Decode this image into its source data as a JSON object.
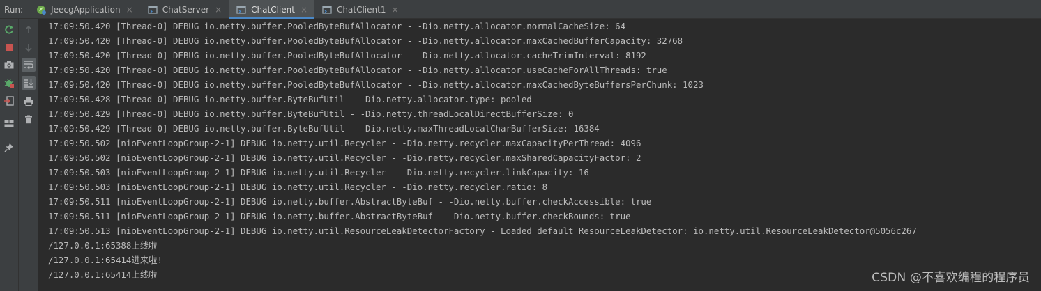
{
  "run_label": "Run:",
  "tabs": [
    {
      "label": "JeecgApplication",
      "icon": "spring-app-icon"
    },
    {
      "label": "ChatServer",
      "icon": "run-config-icon"
    },
    {
      "label": "ChatClient",
      "icon": "run-config-icon",
      "active": true
    },
    {
      "label": "ChatClient1",
      "icon": "run-config-icon"
    }
  ],
  "tab_close_glyph": "×",
  "console_lines": [
    "17:09:50.420 [Thread-0] DEBUG io.netty.buffer.PooledByteBufAllocator - -Dio.netty.allocator.normalCacheSize: 64",
    "17:09:50.420 [Thread-0] DEBUG io.netty.buffer.PooledByteBufAllocator - -Dio.netty.allocator.maxCachedBufferCapacity: 32768",
    "17:09:50.420 [Thread-0] DEBUG io.netty.buffer.PooledByteBufAllocator - -Dio.netty.allocator.cacheTrimInterval: 8192",
    "17:09:50.420 [Thread-0] DEBUG io.netty.buffer.PooledByteBufAllocator - -Dio.netty.allocator.useCacheForAllThreads: true",
    "17:09:50.420 [Thread-0] DEBUG io.netty.buffer.PooledByteBufAllocator - -Dio.netty.allocator.maxCachedByteBuffersPerChunk: 1023",
    "17:09:50.428 [Thread-0] DEBUG io.netty.buffer.ByteBufUtil - -Dio.netty.allocator.type: pooled",
    "17:09:50.429 [Thread-0] DEBUG io.netty.buffer.ByteBufUtil - -Dio.netty.threadLocalDirectBufferSize: 0",
    "17:09:50.429 [Thread-0] DEBUG io.netty.buffer.ByteBufUtil - -Dio.netty.maxThreadLocalCharBufferSize: 16384",
    "17:09:50.502 [nioEventLoopGroup-2-1] DEBUG io.netty.util.Recycler - -Dio.netty.recycler.maxCapacityPerThread: 4096",
    "17:09:50.502 [nioEventLoopGroup-2-1] DEBUG io.netty.util.Recycler - -Dio.netty.recycler.maxSharedCapacityFactor: 2",
    "17:09:50.503 [nioEventLoopGroup-2-1] DEBUG io.netty.util.Recycler - -Dio.netty.recycler.linkCapacity: 16",
    "17:09:50.503 [nioEventLoopGroup-2-1] DEBUG io.netty.util.Recycler - -Dio.netty.recycler.ratio: 8",
    "17:09:50.511 [nioEventLoopGroup-2-1] DEBUG io.netty.buffer.AbstractByteBuf - -Dio.netty.buffer.checkAccessible: true",
    "17:09:50.511 [nioEventLoopGroup-2-1] DEBUG io.netty.buffer.AbstractByteBuf - -Dio.netty.buffer.checkBounds: true",
    "17:09:50.513 [nioEventLoopGroup-2-1] DEBUG io.netty.util.ResourceLeakDetectorFactory - Loaded default ResourceLeakDetector: io.netty.util.ResourceLeakDetector@5056c267",
    "/127.0.0.1:65388上线啦",
    "/127.0.0.1:65414进来啦!",
    "/127.0.0.1:65414上线啦"
  ],
  "toolbar_left": [
    "rerun-icon",
    "stop-icon",
    "camera-icon",
    "debug-bug-icon",
    "exit-icon",
    "layout-icon",
    "pin-icon"
  ],
  "toolbar_right": [
    "up-arrow-icon",
    "down-arrow-icon",
    "soft-wrap-icon",
    "scroll-to-end-icon",
    "print-icon",
    "trash-icon"
  ],
  "watermark": "CSDN @不喜欢编程的程序员",
  "colors": {
    "background": "#2b2b2b",
    "panel": "#3c3f41",
    "console_text": "#bbbbbb",
    "active_tab": "#4e5254",
    "accent": "#4a88c7",
    "rerun_green": "#59a869",
    "stop_red": "#c75450"
  }
}
